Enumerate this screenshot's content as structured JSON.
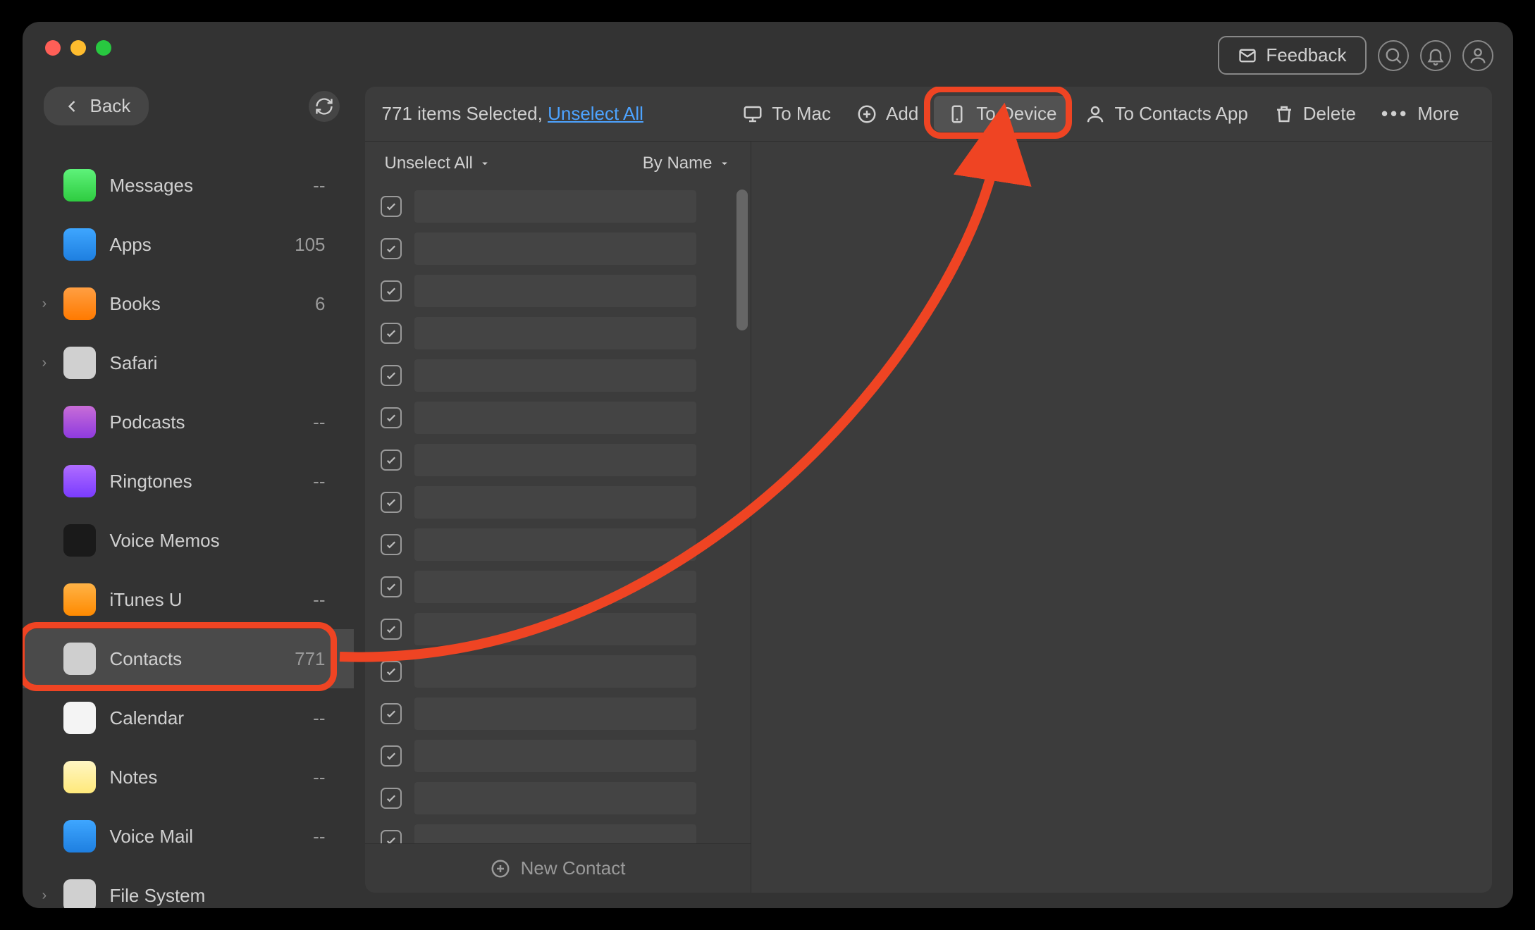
{
  "window": {
    "feedback_label": "Feedback"
  },
  "sidebar_head": {
    "back_label": "Back"
  },
  "sidebar": {
    "items": [
      {
        "key": "messages",
        "label": "Messages",
        "count": "--",
        "expandable": false,
        "icon": "ic-messages"
      },
      {
        "key": "apps",
        "label": "Apps",
        "count": "105",
        "expandable": false,
        "icon": "ic-apps"
      },
      {
        "key": "books",
        "label": "Books",
        "count": "6",
        "expandable": true,
        "icon": "ic-books"
      },
      {
        "key": "safari",
        "label": "Safari",
        "count": "",
        "expandable": true,
        "icon": "ic-safari"
      },
      {
        "key": "podcasts",
        "label": "Podcasts",
        "count": "--",
        "expandable": false,
        "icon": "ic-podcasts"
      },
      {
        "key": "ringtones",
        "label": "Ringtones",
        "count": "--",
        "expandable": false,
        "icon": "ic-ringtones"
      },
      {
        "key": "voicememos",
        "label": "Voice Memos",
        "count": "",
        "expandable": false,
        "icon": "ic-voice"
      },
      {
        "key": "itunesu",
        "label": "iTunes U",
        "count": "--",
        "expandable": false,
        "icon": "ic-itunesu"
      },
      {
        "key": "contacts",
        "label": "Contacts",
        "count": "771",
        "expandable": false,
        "icon": "ic-contacts",
        "selected": true,
        "highlight": true
      },
      {
        "key": "calendar",
        "label": "Calendar",
        "count": "--",
        "expandable": false,
        "icon": "ic-calendar"
      },
      {
        "key": "notes",
        "label": "Notes",
        "count": "--",
        "expandable": false,
        "icon": "ic-notes"
      },
      {
        "key": "voicemail",
        "label": "Voice Mail",
        "count": "--",
        "expandable": false,
        "icon": "ic-voicemail"
      },
      {
        "key": "filesystem",
        "label": "File System",
        "count": "",
        "expandable": true,
        "icon": "ic-files"
      }
    ]
  },
  "toolbar": {
    "selected_text": "771 items Selected, ",
    "unselect_all": "Unselect All",
    "to_mac": "To Mac",
    "add": "Add",
    "to_device": "To Device",
    "to_contacts_app": "To Contacts App",
    "delete": "Delete",
    "more": "More"
  },
  "filterbar": {
    "unselect_all": "Unselect All",
    "sort": "By Name"
  },
  "list": {
    "row_count": 16,
    "new_contact": "New Contact"
  },
  "annotation": {
    "highlight_color": "#ef4423",
    "arrow_from": "sidebar-item-contacts",
    "arrow_to": "toolbar-to-device"
  }
}
